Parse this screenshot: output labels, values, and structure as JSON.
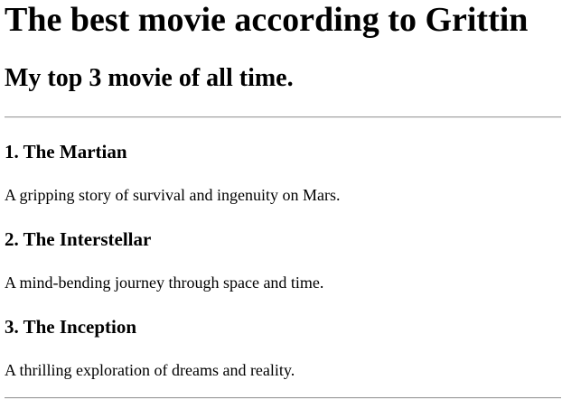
{
  "page": {
    "title": "The best movie according to Grittin",
    "subtitle": "My top 3 movie of all time."
  },
  "movies": [
    {
      "heading": "1. The Martian",
      "description": "A gripping story of survival and ingenuity on Mars."
    },
    {
      "heading": "2. The Interstellar",
      "description": "A mind-bending journey through space and time."
    },
    {
      "heading": "3. The Inception",
      "description": "A thrilling exploration of dreams and reality."
    }
  ]
}
